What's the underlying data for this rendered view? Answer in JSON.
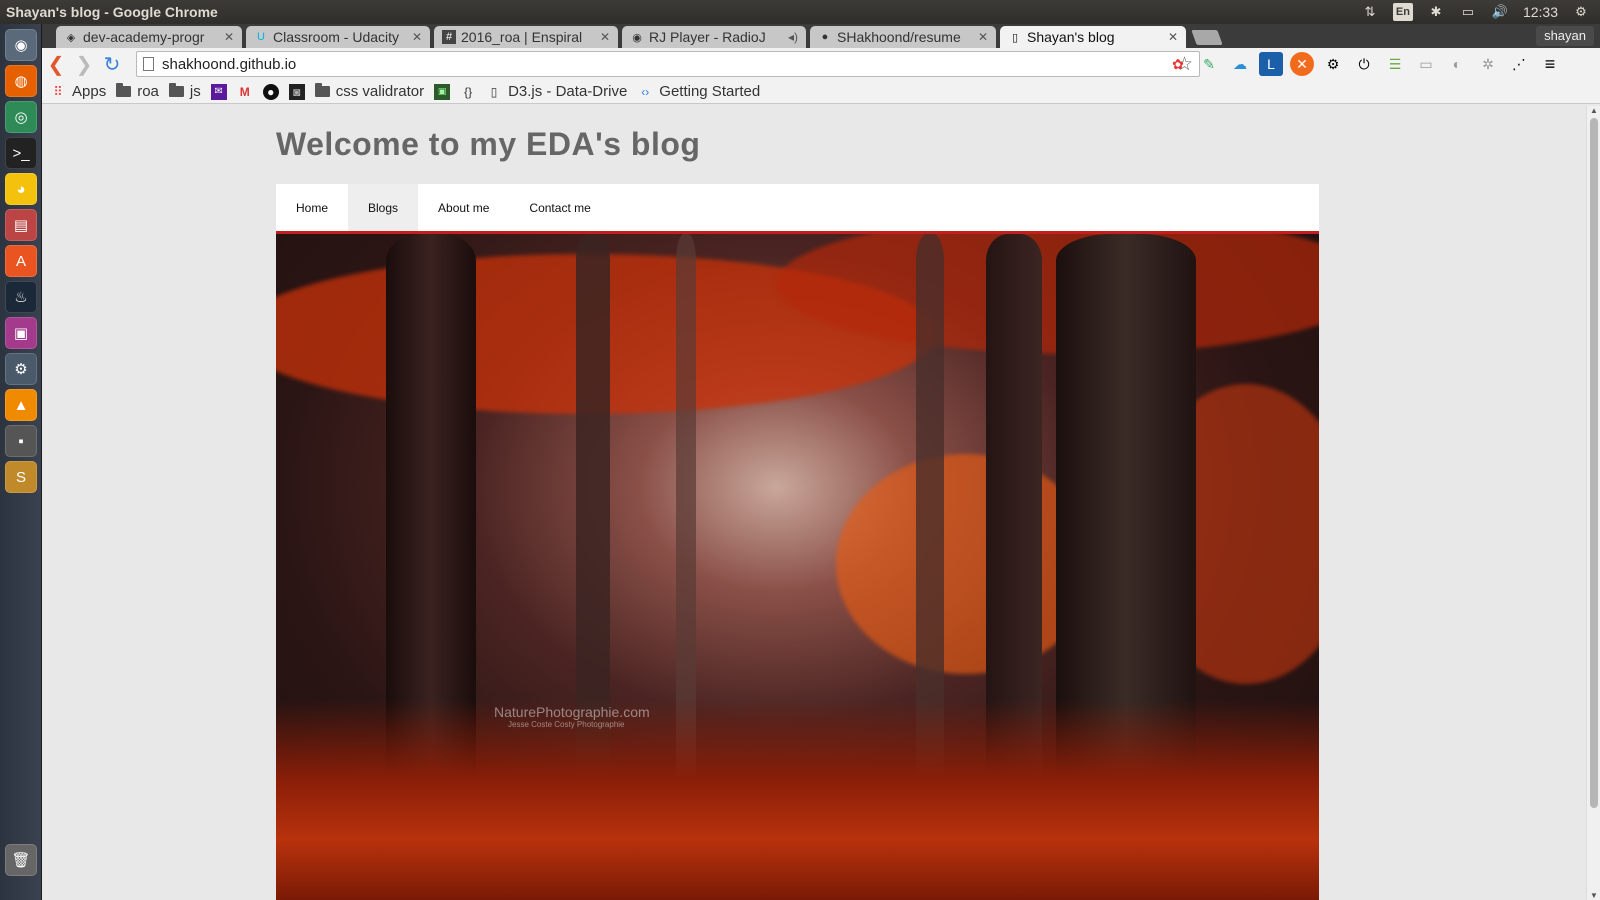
{
  "os": {
    "window_title": "Shayan's blog - Google Chrome",
    "language": "En",
    "clock": "12:33"
  },
  "browser": {
    "tabs": [
      {
        "label": "dev-academy-progr",
        "icon": "diamond-icon",
        "active": false
      },
      {
        "label": "Classroom - Udacity",
        "icon": "udacity-icon",
        "active": false
      },
      {
        "label": "2016_roa | Enspiral",
        "icon": "slack-hash-icon",
        "active": false
      },
      {
        "label": "RJ Player - RadioJ",
        "icon": "radio-icon",
        "active": false
      },
      {
        "label": "SHakhoond/resume",
        "icon": "github-icon",
        "active": false
      },
      {
        "label": "Shayan's blog",
        "icon": "page-icon",
        "active": true
      }
    ],
    "profile_name": "shayan",
    "url": "shakhoond.github.io",
    "bookmarks": [
      {
        "label": "Apps",
        "icon": "apps-grid-icon"
      },
      {
        "label": "roa",
        "icon": "folder-icon"
      },
      {
        "label": "js",
        "icon": "folder-icon"
      },
      {
        "label": "",
        "icon": "yahoo-mail-icon"
      },
      {
        "label": "",
        "icon": "gmail-icon"
      },
      {
        "label": "",
        "icon": "github-icon"
      },
      {
        "label": "",
        "icon": "dark-square-icon"
      },
      {
        "label": "css validrator",
        "icon": "folder-icon"
      },
      {
        "label": "",
        "icon": "green-terminal-icon"
      },
      {
        "label": "",
        "icon": "braces-icon"
      },
      {
        "label": "D3.js - Data-Drive",
        "icon": "page-icon"
      },
      {
        "label": "Getting Started",
        "icon": "code-icon"
      }
    ]
  },
  "page": {
    "site_title": "Welcome to my EDA's blog",
    "nav": [
      {
        "label": "Home",
        "active": false
      },
      {
        "label": "Blogs",
        "active": true
      },
      {
        "label": "About me",
        "active": false
      },
      {
        "label": "Contact me",
        "active": false
      }
    ],
    "hero_watermark": "NaturePhotographie.com",
    "hero_watermark_sub": "Jesse Coste Costy Photographie"
  },
  "colors": {
    "nav_accent": "#c41e1e",
    "title_gray": "#666666"
  }
}
